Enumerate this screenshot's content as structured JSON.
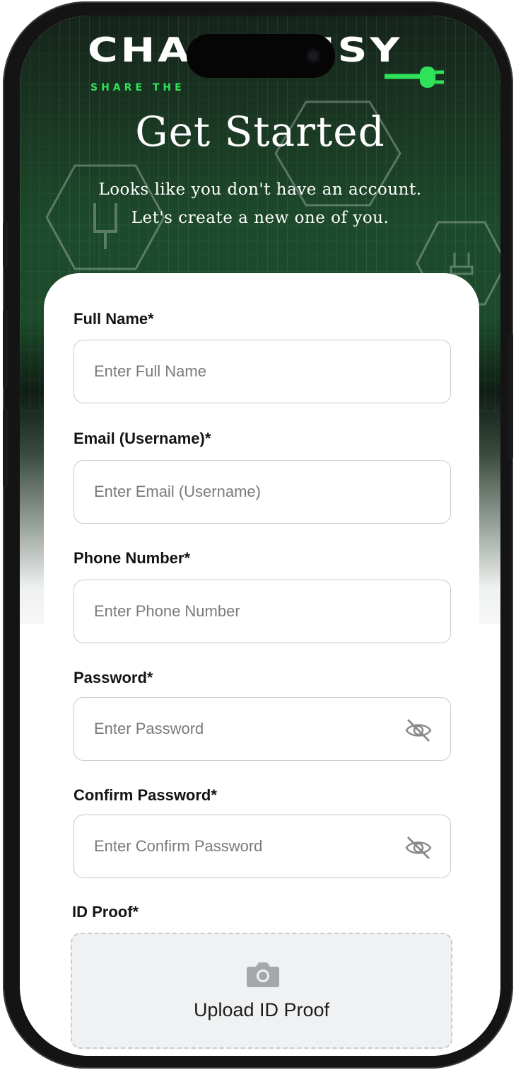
{
  "logo": {
    "wordmark": "CHARGEMSY",
    "tagline": "SHARE THE"
  },
  "header": {
    "title": "Get Started",
    "subtitle_line1": "Looks like you don't have an account.",
    "subtitle_line2": "Let's create a new one of you."
  },
  "form": {
    "full_name": {
      "label": "Full Name*",
      "placeholder": "Enter Full Name"
    },
    "email": {
      "label": "Email (Username)*",
      "placeholder": "Enter Email (Username)"
    },
    "phone": {
      "label": "Phone Number*",
      "placeholder": "Enter Phone Number"
    },
    "password": {
      "label": "Password*",
      "placeholder": "Enter Password"
    },
    "confirm_password": {
      "label": "Confirm Password*",
      "placeholder": "Enter Confirm Password"
    },
    "id_proof": {
      "label": "ID Proof*",
      "upload_label": "Upload ID Proof"
    }
  },
  "colors": {
    "brand_green": "#2ee35a",
    "hero_dark_green": "#1c4a2a"
  },
  "icons": [
    "plug-icon",
    "eye-off-icon",
    "camera-icon"
  ]
}
